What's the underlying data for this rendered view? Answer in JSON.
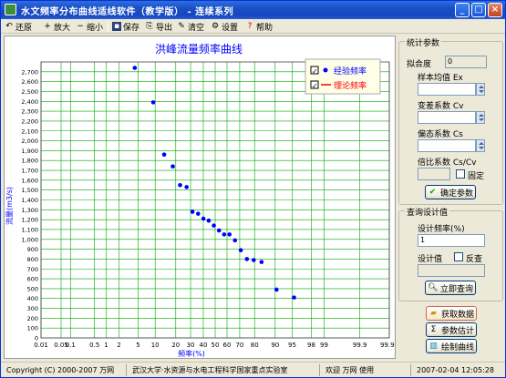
{
  "window": {
    "title": "水文频率分布曲线适线软件（教学版） - 连续系列"
  },
  "toolbar": {
    "restore": "还原",
    "zoom_in": "放大",
    "zoom_out": "缩小",
    "save": "保存",
    "export": "导出",
    "clear": "清空",
    "settings": "设置",
    "help": "帮助",
    "zoom_in_icon_text": "+",
    "zoom_out_icon_text": "−"
  },
  "chart_data": {
    "type": "scatter",
    "title": "洪峰流量频率曲线",
    "xlabel": "频率(%)",
    "ylabel": "流量(m3/s)",
    "x_scale": "probability",
    "x_ticks": [
      "0.01",
      "0.05",
      "0.1",
      "0.5",
      "1",
      "2",
      "5",
      "10",
      "20",
      "30",
      "40",
      "50",
      "60",
      "70",
      "80",
      "90",
      "95",
      "98",
      "99",
      "99.9",
      "99.99"
    ],
    "ylim": [
      0,
      2800
    ],
    "y_ticks": [
      "0",
      "100",
      "200",
      "300",
      "400",
      "500",
      "600",
      "700",
      "800",
      "900",
      "1,000",
      "1,100",
      "1,200",
      "1,300",
      "1,400",
      "1,500",
      "1,600",
      "1,700",
      "1,800",
      "1,900",
      "2,000",
      "2,100",
      "2,200",
      "2,300",
      "2,400",
      "2,500",
      "2,600",
      "2,700"
    ],
    "grid": true,
    "legend": {
      "placement": "top-right",
      "entries": [
        {
          "name": "经验频率",
          "checked": true,
          "color": "#0000ff"
        },
        {
          "name": "理论频率",
          "checked": true,
          "color": "#ff0000"
        }
      ]
    },
    "series": [
      {
        "name": "经验频率",
        "points": [
          [
            4.3,
            2740
          ],
          [
            9.3,
            2390
          ],
          [
            13.8,
            1860
          ],
          [
            18.3,
            1740
          ],
          [
            22.7,
            1550
          ],
          [
            27.1,
            1530
          ],
          [
            31.4,
            1280
          ],
          [
            35.8,
            1260
          ],
          [
            40.1,
            1210
          ],
          [
            44.5,
            1190
          ],
          [
            48.9,
            1140
          ],
          [
            53.3,
            1090
          ],
          [
            57.6,
            1050
          ],
          [
            62,
            1050
          ],
          [
            66.4,
            990
          ],
          [
            70.8,
            890
          ],
          [
            75.1,
            800
          ],
          [
            79.5,
            790
          ],
          [
            83.9,
            770
          ],
          [
            90.5,
            490
          ],
          [
            95.4,
            410
          ]
        ]
      }
    ]
  },
  "stats": {
    "group_title": "统计参数",
    "fit_label": "拟合度",
    "fit_value": "0",
    "mean_label": "样本均值 Ex",
    "cv_label": "变差系数 Cv",
    "cs_label": "偏态系数 Cs",
    "ratio_label": "倍比系数 Cs/Cv",
    "fix_label": "固定",
    "confirm_button": "确定参数"
  },
  "query": {
    "group_title": "查询设计值",
    "freq_label": "设计频率(%)",
    "freq_value": "1",
    "design_label": "设计值",
    "reverse_label": "反查",
    "query_button": "立即查询"
  },
  "actions": {
    "get_data": "获取数据",
    "estimate": "参数估计",
    "plot": "绘制曲线"
  },
  "status": {
    "copyright": "Copyright (C) 2000-2007 万网",
    "lab": "武汉大学·水资源与水电工程科学国家重点实验室",
    "user": "欢迎 万网 使用",
    "time": "2007-02-04 12:05:28"
  },
  "colors": {
    "grid": "#00aa00",
    "points": "#0000ff",
    "title": "#0000ff",
    "theory": "#ff0000"
  }
}
